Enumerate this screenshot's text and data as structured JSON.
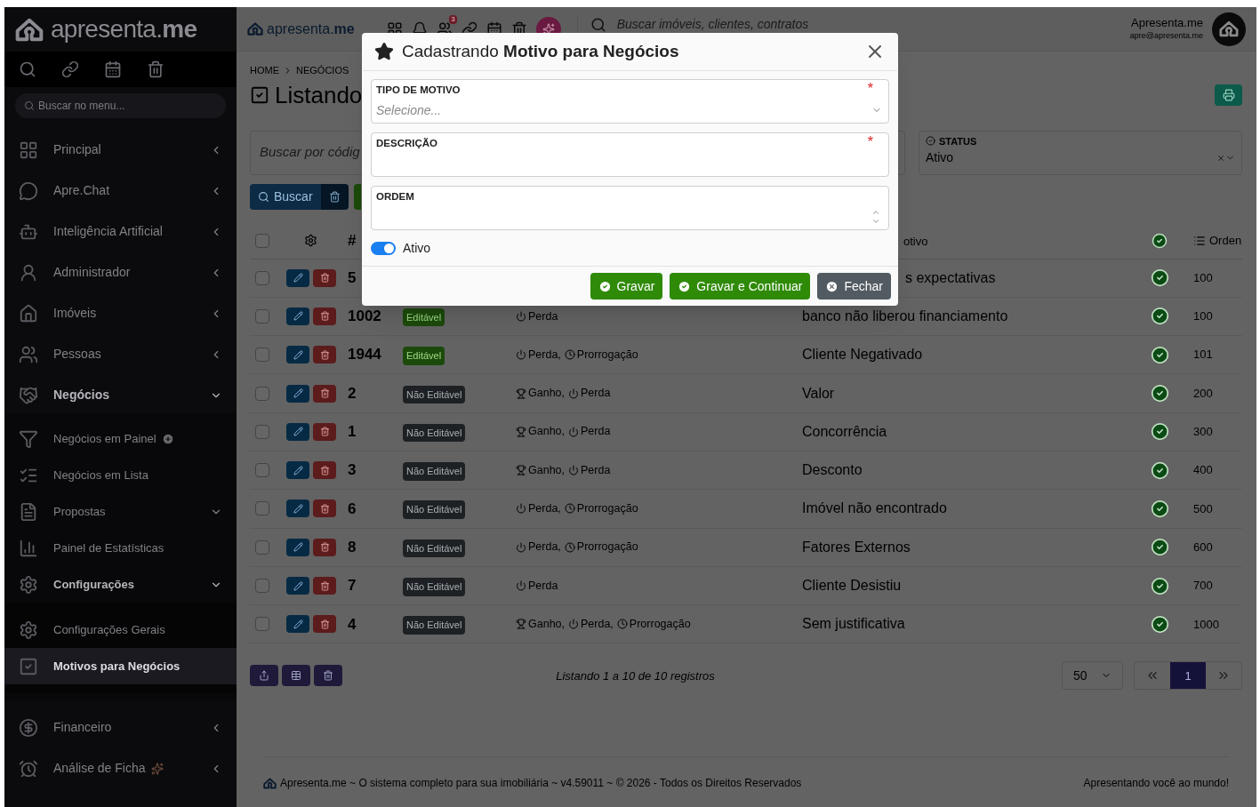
{
  "sidebar": {
    "logo": "apresenta.**me**",
    "search": {
      "placeholder": "Buscar no menu..."
    },
    "items": [
      {
        "label": "Principal",
        "expanded": false,
        "selected": false
      },
      {
        "label": "Apre.Chat",
        "expanded": false,
        "selected": false
      },
      {
        "label": "Inteligência Artificial",
        "expanded": false,
        "selected": false
      },
      {
        "label": "Administrador",
        "expanded": false,
        "selected": false
      },
      {
        "label": "Imóveis",
        "expanded": false,
        "selected": false
      },
      {
        "label": "Pessoas",
        "expanded": false,
        "selected": false
      },
      {
        "label": "Negócios",
        "expanded": true,
        "selected": false,
        "children": [
          {
            "label": "Negócios em Painel",
            "expanded": false,
            "selected": false
          },
          {
            "label": "Negócios em Lista",
            "expanded": false,
            "selected": false
          },
          {
            "label": "Propostas",
            "expanded": false,
            "selected": false
          },
          {
            "label": "Painel de Estatísticas",
            "expanded": false,
            "selected": false
          },
          {
            "label": "Configurações",
            "expanded": true,
            "selected": false,
            "children": [
              {
                "label": "Configurações Gerais",
                "expanded": false,
                "selected": false
              },
              {
                "label": "Motivos para Negócios",
                "expanded": false,
                "selected": true
              }
            ]
          }
        ]
      },
      {
        "label": "Financeiro",
        "expanded": false,
        "selected": false
      },
      {
        "label": "Análise de Ficha",
        "expanded": false,
        "selected": false
      }
    ]
  },
  "topbar": {
    "logo": "apresenta.**me**",
    "notification_count": "3",
    "search": {
      "placeholder": "Buscar imóveis, clientes, contratos"
    },
    "user": {
      "name": "Apresenta.me",
      "email": "apre@apresenta.me"
    }
  },
  "breadcrumb": [
    "HOME",
    "NEGÓCIOS"
  ],
  "page_title": "Listando",
  "filters": {
    "search": {
      "placeholder": "Buscar por códig"
    },
    "status": {
      "label": "STATUS",
      "value": "Ativo"
    },
    "search_button": "Buscar"
  },
  "table": {
    "all_checked": false,
    "columns": [
      "#",
      "otivo",
      "Orden"
    ],
    "rows": [
      {
        "id": "5",
        "checked": false,
        "motivo": "s expectativas",
        "active": true,
        "ordem": "100"
      },
      {
        "id": "1002",
        "checked": false,
        "badge": {
          "label": "Editável",
          "editable": true
        },
        "tipos": [
          {
            "kind": "perda",
            "label": "Perda"
          }
        ],
        "motivo": "banco não liberou financiamento",
        "active": true,
        "ordem": "100"
      },
      {
        "id": "1944",
        "checked": false,
        "badge": {
          "label": "Editável",
          "editable": true
        },
        "tipos": [
          {
            "kind": "perda",
            "label": "Perda,"
          },
          {
            "kind": "prorrogacao",
            "label": "Prorrogação"
          }
        ],
        "motivo": "Cliente Negativado",
        "active": true,
        "ordem": "101"
      },
      {
        "id": "2",
        "checked": false,
        "badge": {
          "label": "Não Editável",
          "editable": false
        },
        "tipos": [
          {
            "kind": "ganho",
            "label": "Ganho,"
          },
          {
            "kind": "perda",
            "label": "Perda"
          }
        ],
        "motivo": "Valor",
        "active": true,
        "ordem": "200"
      },
      {
        "id": "1",
        "checked": false,
        "badge": {
          "label": "Não Editável",
          "editable": false
        },
        "tipos": [
          {
            "kind": "ganho",
            "label": "Ganho,"
          },
          {
            "kind": "perda",
            "label": "Perda"
          }
        ],
        "motivo": "Concorrência",
        "active": true,
        "ordem": "300"
      },
      {
        "id": "3",
        "checked": false,
        "badge": {
          "label": "Não Editável",
          "editable": false
        },
        "tipos": [
          {
            "kind": "ganho",
            "label": "Ganho,"
          },
          {
            "kind": "perda",
            "label": "Perda"
          }
        ],
        "motivo": "Desconto",
        "active": true,
        "ordem": "400"
      },
      {
        "id": "6",
        "checked": false,
        "badge": {
          "label": "Não Editável",
          "editable": false
        },
        "tipos": [
          {
            "kind": "perda",
            "label": "Perda,"
          },
          {
            "kind": "prorrogacao",
            "label": "Prorrogação"
          }
        ],
        "motivo": "Imóvel não encontrado",
        "active": true,
        "ordem": "500"
      },
      {
        "id": "8",
        "checked": false,
        "badge": {
          "label": "Não Editável",
          "editable": false
        },
        "tipos": [
          {
            "kind": "perda",
            "label": "Perda,"
          },
          {
            "kind": "prorrogacao",
            "label": "Prorrogação"
          }
        ],
        "motivo": "Fatores Externos",
        "active": true,
        "ordem": "600"
      },
      {
        "id": "7",
        "checked": false,
        "badge": {
          "label": "Não Editável",
          "editable": false
        },
        "tipos": [
          {
            "kind": "perda",
            "label": "Perda"
          }
        ],
        "motivo": "Cliente Desistiu",
        "active": true,
        "ordem": "700"
      },
      {
        "id": "4",
        "checked": false,
        "badge": {
          "label": "Não Editável",
          "editable": false
        },
        "tipos": [
          {
            "kind": "ganho",
            "label": "Ganho,"
          },
          {
            "kind": "perda",
            "label": "Perda,"
          },
          {
            "kind": "prorrogacao",
            "label": "Prorrogação"
          }
        ],
        "motivo": "Sem justificativa",
        "active": true,
        "ordem": "1000"
      }
    ]
  },
  "pagination": {
    "summary": "Listando 1 a 10 de 10 registros",
    "page_size": "50",
    "pages": [
      {
        "label": "1",
        "selected": true
      }
    ]
  },
  "footer": {
    "left": "Apresenta.me ~ O sistema completo para sua imobiliária ~ v4.59011 ~ © 2026 - Todos os Direitos Reservados",
    "right": "Apresentando você ao mundo!"
  },
  "modal": {
    "title": "Cadastrando **Motivo para Negócios**",
    "fields": [
      {
        "kind": "select",
        "label": "TIPO DE MOTIVO",
        "required_mark": "*",
        "placeholder": "Selecione..."
      },
      {
        "kind": "text",
        "label": "DESCRIÇÃO",
        "required_mark": "*"
      },
      {
        "kind": "number",
        "label": "ORDEM"
      }
    ],
    "toggle": {
      "label": "Ativo",
      "on": true
    },
    "buttons": [
      {
        "kind": "save",
        "label": "Gravar"
      },
      {
        "kind": "save",
        "label": "Gravar e Continuar"
      },
      {
        "kind": "close",
        "label": "Fechar"
      }
    ]
  }
}
